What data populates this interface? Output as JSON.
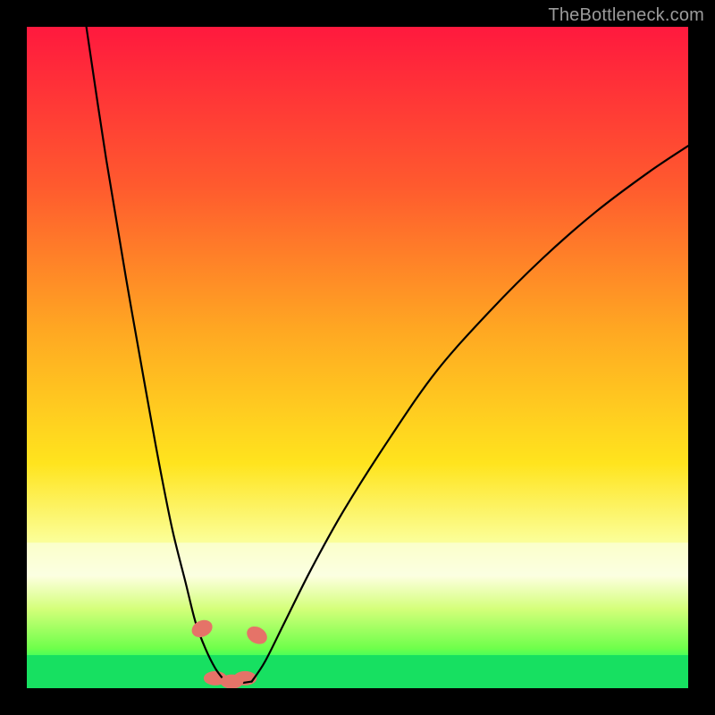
{
  "watermark": "TheBottleneck.com",
  "chart_data": {
    "type": "line",
    "title": "",
    "xlabel": "",
    "ylabel": "",
    "xlim": [
      0,
      100
    ],
    "ylim": [
      0,
      100
    ],
    "whitish_band": {
      "y_from": 78,
      "y_to": 83
    },
    "green_band": {
      "y_from": 95,
      "y_to": 100
    },
    "gradient_stops": [
      {
        "offset": 0.0,
        "color": "#ff193e"
      },
      {
        "offset": 0.24,
        "color": "#ff5a2e"
      },
      {
        "offset": 0.46,
        "color": "#ffa822"
      },
      {
        "offset": 0.66,
        "color": "#ffe41e"
      },
      {
        "offset": 0.78,
        "color": "#fbff9a"
      },
      {
        "offset": 0.83,
        "color": "#fdffe0"
      },
      {
        "offset": 0.88,
        "color": "#d4ff7a"
      },
      {
        "offset": 0.94,
        "color": "#6eff4b"
      },
      {
        "offset": 0.96,
        "color": "#2bff65"
      },
      {
        "offset": 1.0,
        "color": "#15e765"
      }
    ],
    "series": [
      {
        "name": "left-curve",
        "x": [
          9,
          12,
          15,
          18,
          20,
          22,
          24,
          25.5,
          27,
          28.5,
          30
        ],
        "y": [
          0,
          20,
          38,
          55,
          66,
          76,
          84,
          90,
          94,
          97,
          99
        ]
      },
      {
        "name": "right-curve",
        "x": [
          34,
          36,
          39,
          43,
          48,
          55,
          62,
          70,
          78,
          86,
          94,
          100
        ],
        "y": [
          99,
          96,
          90,
          82,
          73,
          62,
          52,
          43,
          35,
          28,
          22,
          18
        ]
      }
    ],
    "markers": [
      {
        "name": "m1",
        "x": 26.5,
        "y": 91
      },
      {
        "name": "m2",
        "x": 28.5,
        "y": 98.5
      },
      {
        "name": "m3",
        "x": 31.0,
        "y": 99
      },
      {
        "name": "m4",
        "x": 33.0,
        "y": 98.5
      },
      {
        "name": "m5",
        "x": 34.8,
        "y": 92
      }
    ],
    "marker_color": "#e57368",
    "curve_color": "#000000"
  }
}
